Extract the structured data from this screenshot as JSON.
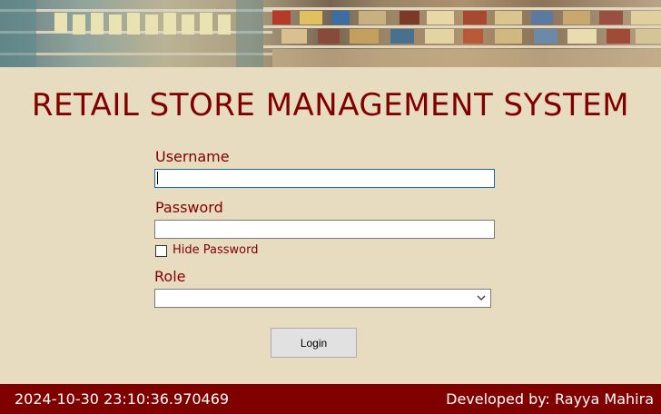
{
  "banner": {
    "image": "retail-shelves-photo"
  },
  "title": "RETAIL STORE MANAGEMENT SYSTEM",
  "form": {
    "username_label": "Username",
    "username_value": "",
    "password_label": "Password",
    "password_value": "",
    "hide_password_label": "Hide Password",
    "hide_password_checked": false,
    "role_label": "Role",
    "role_value": "",
    "login_label": "Login"
  },
  "footer": {
    "timestamp": "2024-10-30 23:10:36.970469",
    "developer": "Developed by: Rayya Mahira"
  },
  "colors": {
    "background": "#e8dcc0",
    "accent": "#800000"
  }
}
